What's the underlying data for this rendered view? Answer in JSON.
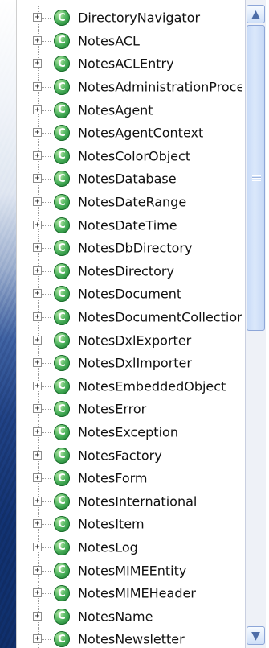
{
  "tree": {
    "items": [
      {
        "label": "DirectoryNavigator"
      },
      {
        "label": "NotesACL"
      },
      {
        "label": "NotesACLEntry"
      },
      {
        "label": "NotesAdministrationProce"
      },
      {
        "label": "NotesAgent"
      },
      {
        "label": "NotesAgentContext"
      },
      {
        "label": "NotesColorObject"
      },
      {
        "label": "NotesDatabase"
      },
      {
        "label": "NotesDateRange"
      },
      {
        "label": "NotesDateTime"
      },
      {
        "label": "NotesDbDirectory"
      },
      {
        "label": "NotesDirectory"
      },
      {
        "label": "NotesDocument"
      },
      {
        "label": "NotesDocumentCollection"
      },
      {
        "label": "NotesDxlExporter"
      },
      {
        "label": "NotesDxlImporter"
      },
      {
        "label": "NotesEmbeddedObject"
      },
      {
        "label": "NotesError"
      },
      {
        "label": "NotesException"
      },
      {
        "label": "NotesFactory"
      },
      {
        "label": "NotesForm"
      },
      {
        "label": "NotesInternational"
      },
      {
        "label": "NotesItem"
      },
      {
        "label": "NotesLog"
      },
      {
        "label": "NotesMIMEEntity"
      },
      {
        "label": "NotesMIMEHeader"
      },
      {
        "label": "NotesName"
      },
      {
        "label": "NotesNewsletter"
      }
    ]
  },
  "icons": {
    "class_glyph": "C",
    "expander_glyph": "+",
    "scroll_up_glyph": "▲",
    "scroll_down_glyph": "▼"
  },
  "colors": {
    "class_icon": "#2a8f3f",
    "scroll_accent": "#8da6d8"
  }
}
